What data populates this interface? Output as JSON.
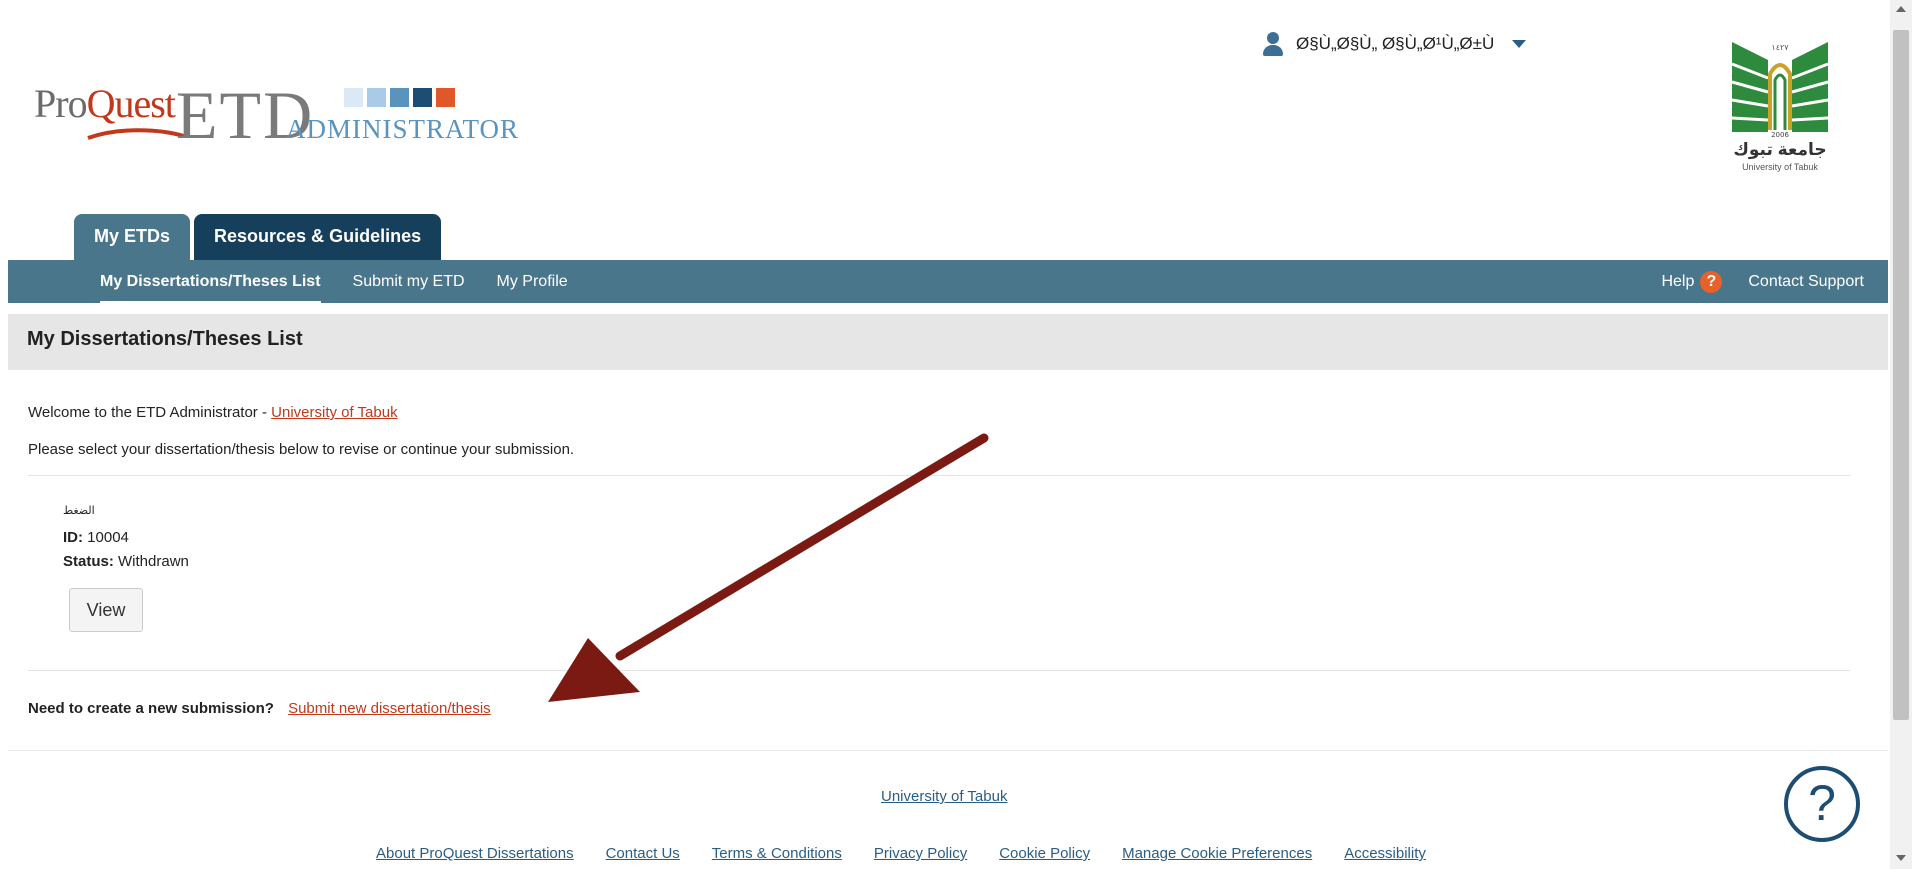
{
  "header": {
    "brand": {
      "proquest_pro": "Pro",
      "proquest_quest": "Quest",
      "etd": "ETD",
      "administrator": "ADMINISTRATOR",
      "square_colors": [
        "#dbe9f5",
        "#a9cbe8",
        "#5b93bf",
        "#1e4d73",
        "#e0582a"
      ]
    },
    "user_menu": {
      "name": "Ø§Ù„Ø§Ù„ Ø§Ù„Ø¹Ù„Ø±Ù",
      "icon": "user-icon",
      "dropdown_icon": "caret-down-icon"
    },
    "university_logo": {
      "arabic_name": "جامعة تبوك",
      "english_name": "University of Tabuk",
      "year_top": "١٤٢٧",
      "year": "2006"
    }
  },
  "tabs": [
    {
      "label": "My ETDs",
      "active": true
    },
    {
      "label": "Resources & Guidelines",
      "active": false
    }
  ],
  "subnav": {
    "items": [
      {
        "label": "My Dissertations/Theses List",
        "current": true
      },
      {
        "label": "Submit my ETD",
        "current": false
      },
      {
        "label": "My Profile",
        "current": false
      }
    ],
    "help_label": "Help",
    "help_icon_glyph": "?",
    "contact_label": "Contact Support"
  },
  "page": {
    "title": "My Dissertations/Theses List",
    "welcome_text": "Welcome to the ETD Administrator - ",
    "welcome_link": "University of Tabuk",
    "instructions": "Please select your dissertation/thesis below to revise or continue your submission.",
    "submission": {
      "title": "الضغط",
      "id_label": "ID:",
      "id_value": "10004",
      "status_label": "Status:",
      "status_value": "Withdrawn",
      "view_button": "View"
    },
    "new_submission_prompt": "Need to create a new submission?",
    "new_submission_link": "Submit new dissertation/thesis",
    "annotation_arrow_color": "#7a1a12"
  },
  "footer": {
    "university_link": "University of Tabuk",
    "links": [
      "About ProQuest Dissertations",
      "Contact Us",
      "Terms & Conditions",
      "Privacy Policy",
      "Cookie Policy",
      "Manage Cookie Preferences",
      "Accessibility"
    ],
    "help_widget_glyph": "?"
  }
}
